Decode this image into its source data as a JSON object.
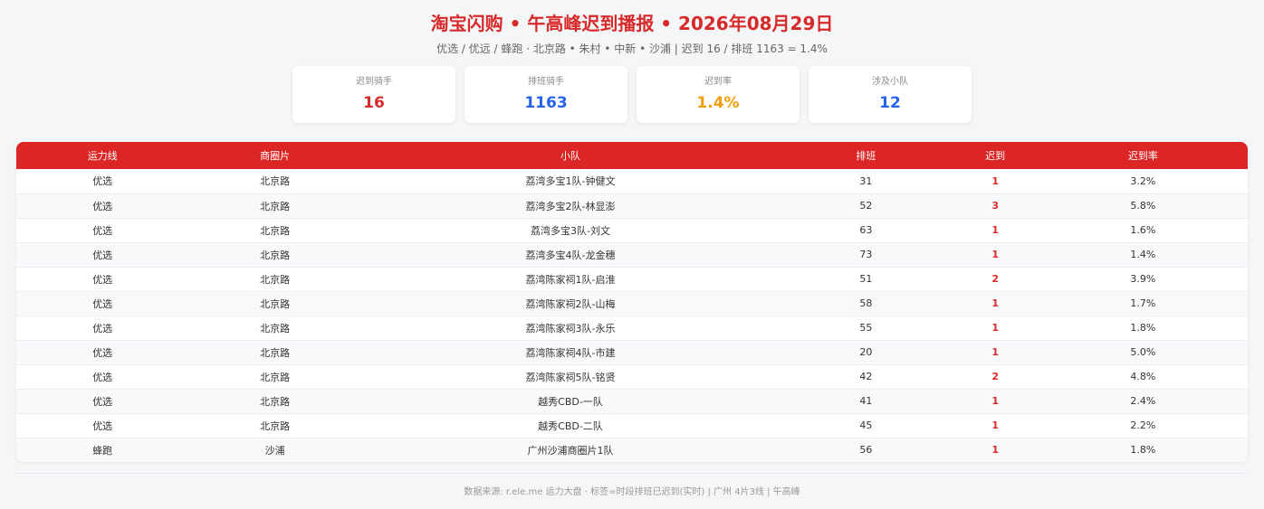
{
  "header": {
    "title": "淘宝闪购 • 午高峰迟到播报 • 2026年08月29日",
    "subtitle": "优选 / 优远 / 蜂跑 · 北京路 • 朱村 • 中新 • 沙浦 | 迟到 16 / 排班 1163 = 1.4%"
  },
  "stats": [
    {
      "label": "迟到骑手",
      "value": "16",
      "color": "#d72a2a"
    },
    {
      "label": "排班骑手",
      "value": "1163",
      "color": "#2563eb"
    },
    {
      "label": "迟到率",
      "value": "1.4%",
      "color": "#f59e0b"
    },
    {
      "label": "涉及小队",
      "value": "12",
      "color": "#2563eb"
    }
  ],
  "table": {
    "columns": [
      "运力线",
      "商圈片",
      "小队",
      "排班",
      "迟到",
      "迟到率"
    ],
    "rows": [
      [
        "优选",
        "北京路",
        "荔湾多宝1队-钟健文",
        "31",
        "1",
        "3.2%"
      ],
      [
        "优选",
        "北京路",
        "荔湾多宝2队-林显澎",
        "52",
        "3",
        "5.8%"
      ],
      [
        "优选",
        "北京路",
        "荔湾多宝3队-刘文",
        "63",
        "1",
        "1.6%"
      ],
      [
        "优选",
        "北京路",
        "荔湾多宝4队-龙金穗",
        "73",
        "1",
        "1.4%"
      ],
      [
        "优选",
        "北京路",
        "荔湾陈家祠1队-启淮",
        "51",
        "2",
        "3.9%"
      ],
      [
        "优选",
        "北京路",
        "荔湾陈家祠2队-山梅",
        "58",
        "1",
        "1.7%"
      ],
      [
        "优选",
        "北京路",
        "荔湾陈家祠3队-永乐",
        "55",
        "1",
        "1.8%"
      ],
      [
        "优选",
        "北京路",
        "荔湾陈家祠4队-市建",
        "20",
        "1",
        "5.0%"
      ],
      [
        "优选",
        "北京路",
        "荔湾陈家祠5队-铭贤",
        "42",
        "2",
        "4.8%"
      ],
      [
        "优选",
        "北京路",
        "越秀CBD-一队",
        "41",
        "1",
        "2.4%"
      ],
      [
        "优选",
        "北京路",
        "越秀CBD-二队",
        "45",
        "1",
        "2.2%"
      ],
      [
        "蜂跑",
        "沙浦",
        "广州沙浦商圈片1队",
        "56",
        "1",
        "1.8%"
      ]
    ]
  },
  "footer": {
    "text": "数据来源: r.ele.me 运力大盘 · 标签=时段排班已迟到(实时) | 广州 4片3线 | 午高峰"
  }
}
